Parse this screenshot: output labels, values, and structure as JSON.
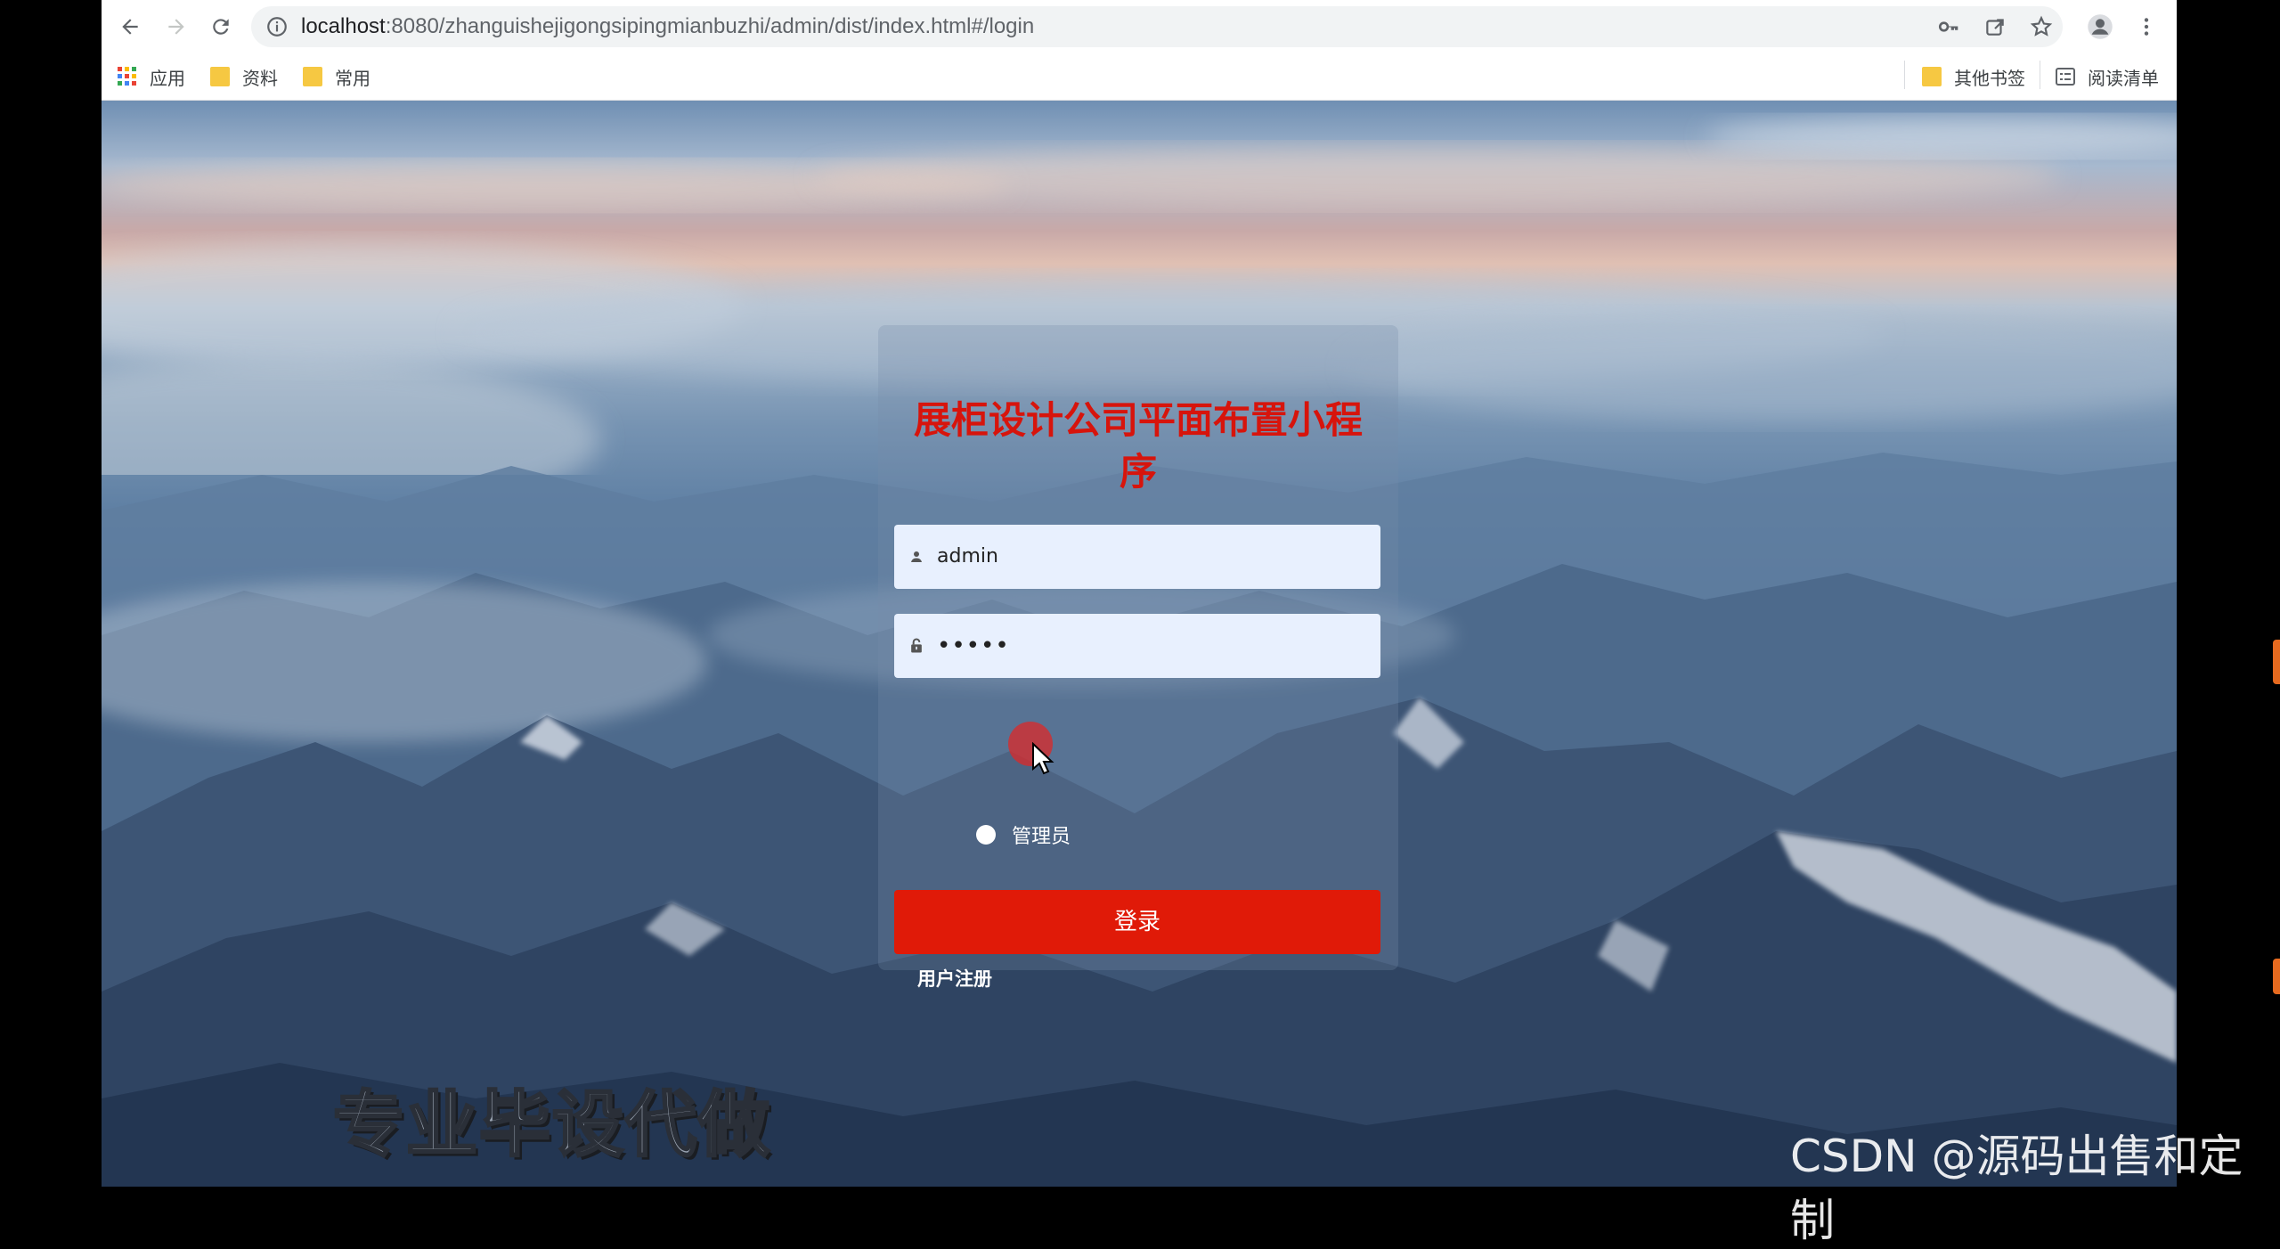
{
  "browser": {
    "url_host": "localhost",
    "url_rest": ":8080/zhanguishejigongsipingmianbuzhi/admin/dist/index.html#/login",
    "bookmarks": [
      {
        "label": "应用",
        "icon": "apps-grid-icon"
      },
      {
        "label": "资料",
        "icon": "folder-icon"
      },
      {
        "label": "常用",
        "icon": "folder-icon"
      }
    ],
    "bookmarks_right": [
      {
        "label": "其他书签",
        "icon": "folder-icon"
      },
      {
        "label": "阅读清单",
        "icon": "reading-list-icon"
      }
    ]
  },
  "login": {
    "title": "展柜设计公司平面布置小程序",
    "username_value": "admin",
    "password_value": "•••••",
    "role_label": "管理员",
    "login_button": "登录",
    "register_link": "用户注册"
  },
  "overlay": {
    "promo_text": "专业毕设代做",
    "watermark": "CSDN @源码出售和定制"
  },
  "colors": {
    "title": "#d7140c",
    "login_button": "#e01a08",
    "input_bg": "#e8f0fe"
  }
}
